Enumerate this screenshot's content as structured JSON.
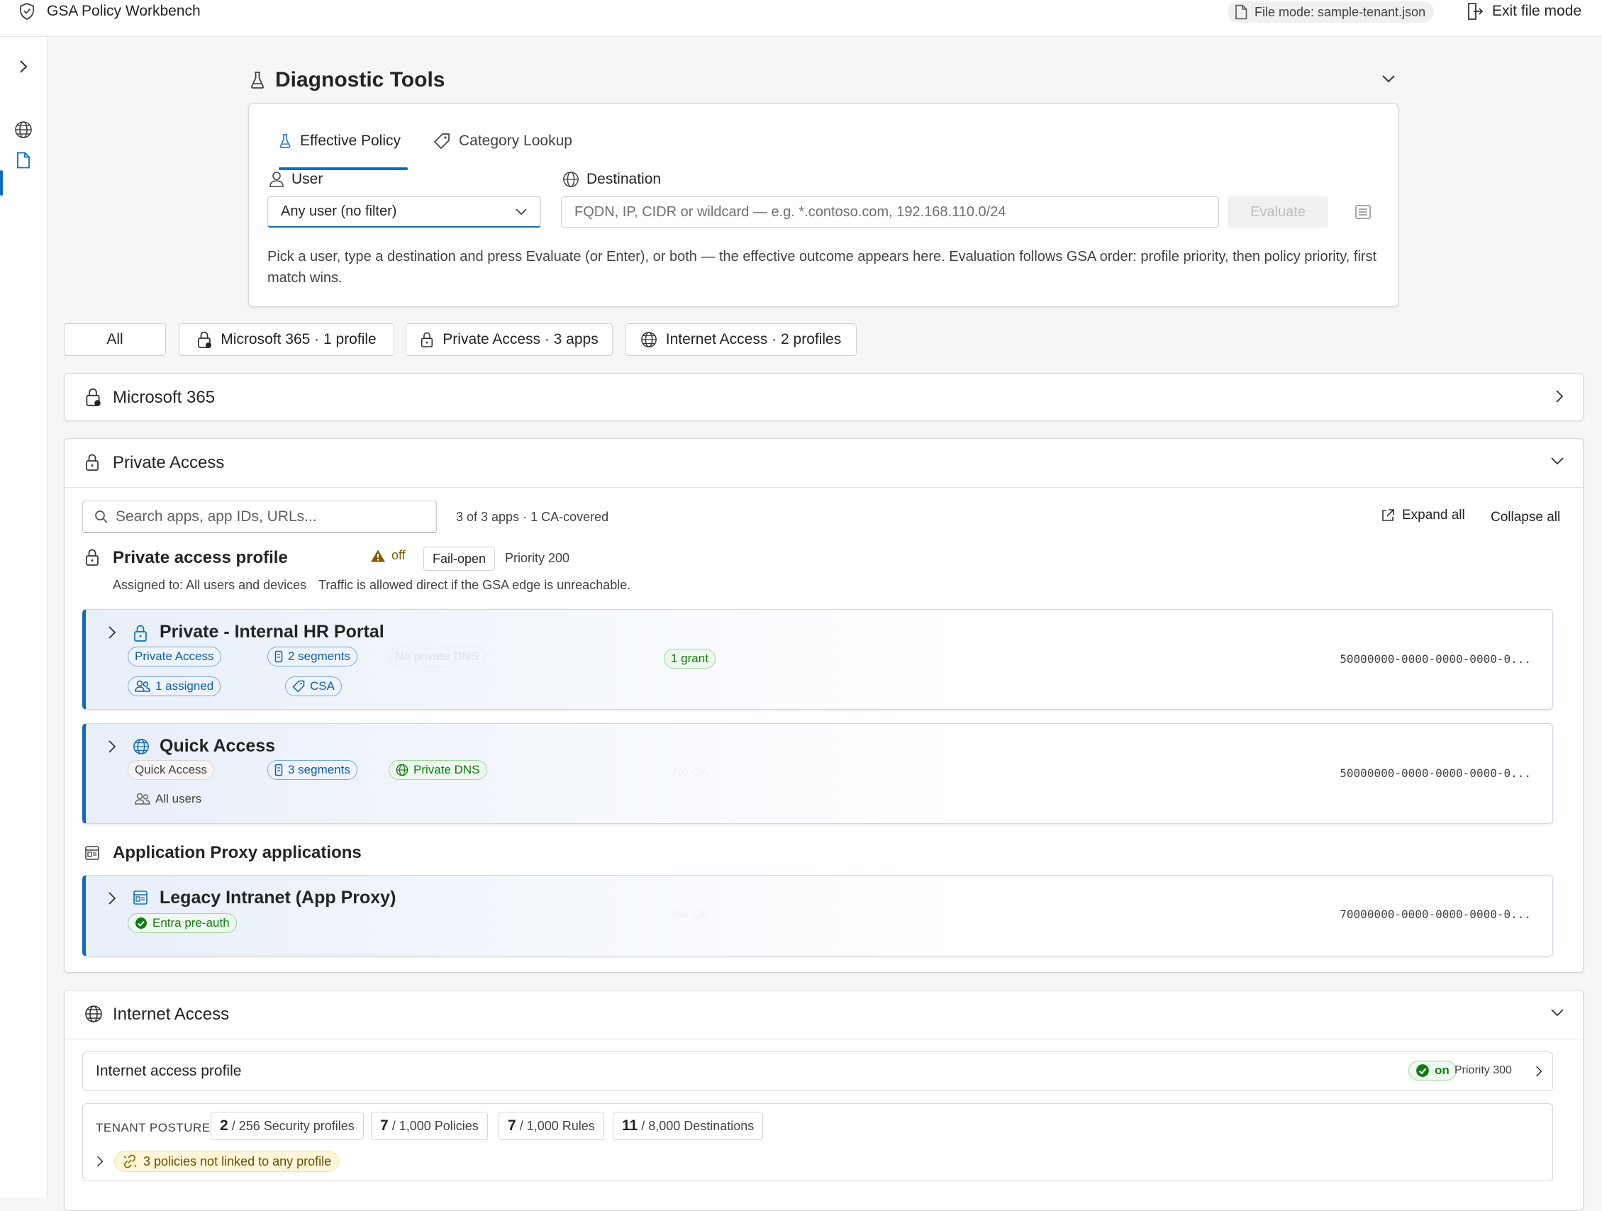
{
  "app": {
    "title": "GSA Policy Workbench",
    "file_mode_label": "File mode: sample-tenant.json",
    "exit_label": "Exit file mode"
  },
  "colors": {
    "accent": "#0f6cbd",
    "success": "#107c10",
    "warning": "#835b00"
  },
  "diagnostics": {
    "title": "Diagnostic Tools",
    "tabs": [
      {
        "label": "Effective Policy",
        "icon": "flask-icon",
        "active": true
      },
      {
        "label": "Category Lookup",
        "icon": "tag-icon",
        "active": false
      }
    ],
    "user_label": "User",
    "user_value": "Any user (no filter)",
    "destination_label": "Destination",
    "destination_placeholder": "FQDN, IP, CIDR or wildcard — e.g. *.contoso.com, 192.168.110.0/24",
    "evaluate_label": "Evaluate",
    "help_text": "Pick a user, type a destination and press Evaluate (or Enter), or both — the effective outcome appears here. Evaluation follows GSA order: profile priority, then policy priority, first match wins."
  },
  "filters": [
    "All",
    "Microsoft 365 · 1 profile",
    "Private Access · 3 apps",
    "Internet Access · 2 profiles"
  ],
  "sections": {
    "m365": {
      "title": "Microsoft 365"
    },
    "private": {
      "title": "Private Access",
      "search_placeholder": "Search apps, app IDs, URLs...",
      "count_text": "3 of 3 apps · 1 CA-covered",
      "expand_all": "Expand all",
      "collapse_all": "Collapse all",
      "profile": {
        "title": "Private access profile",
        "state": "off",
        "mode": "Fail-open",
        "priority": "Priority 200",
        "assigned": "Assigned to: All users and devices",
        "note": "Traffic is allowed direct if the GSA edge is unreachable."
      },
      "apps": [
        {
          "title": "Private - Internal HR Portal",
          "type": "Private Access",
          "segments": "2 segments",
          "dns": "No private DNS",
          "assigned": "1 assigned",
          "tag": "CSA",
          "grant": "1 grant",
          "id": "50000000-0000-0000-0000-0..."
        },
        {
          "title": "Quick Access",
          "type": "Quick Access",
          "segments": "3 segments",
          "dns": "Private DNS",
          "assigned": "All users",
          "ca": "No CA",
          "id": "50000000-0000-0000-0000-0..."
        }
      ],
      "app_proxy_heading": "Application Proxy applications",
      "proxy_apps": [
        {
          "title": "Legacy Intranet (App Proxy)",
          "preauth": "Entra pre-auth",
          "ca": "No CA",
          "id": "70000000-0000-0000-0000-0..."
        }
      ]
    },
    "internet": {
      "title": "Internet Access",
      "profile_title": "Internet access profile",
      "profile_state": "on",
      "profile_priority": "Priority 300",
      "posture_label": "TENANT POSTURE",
      "stats": [
        {
          "value": "2",
          "limit": "/ 256 Security profiles"
        },
        {
          "value": "7",
          "limit": "/ 1,000 Policies"
        },
        {
          "value": "7",
          "limit": "/ 1,000 Rules"
        },
        {
          "value": "11",
          "limit": "/ 8,000 Destinations"
        }
      ],
      "unlinked": "3 policies not linked to any profile"
    }
  }
}
